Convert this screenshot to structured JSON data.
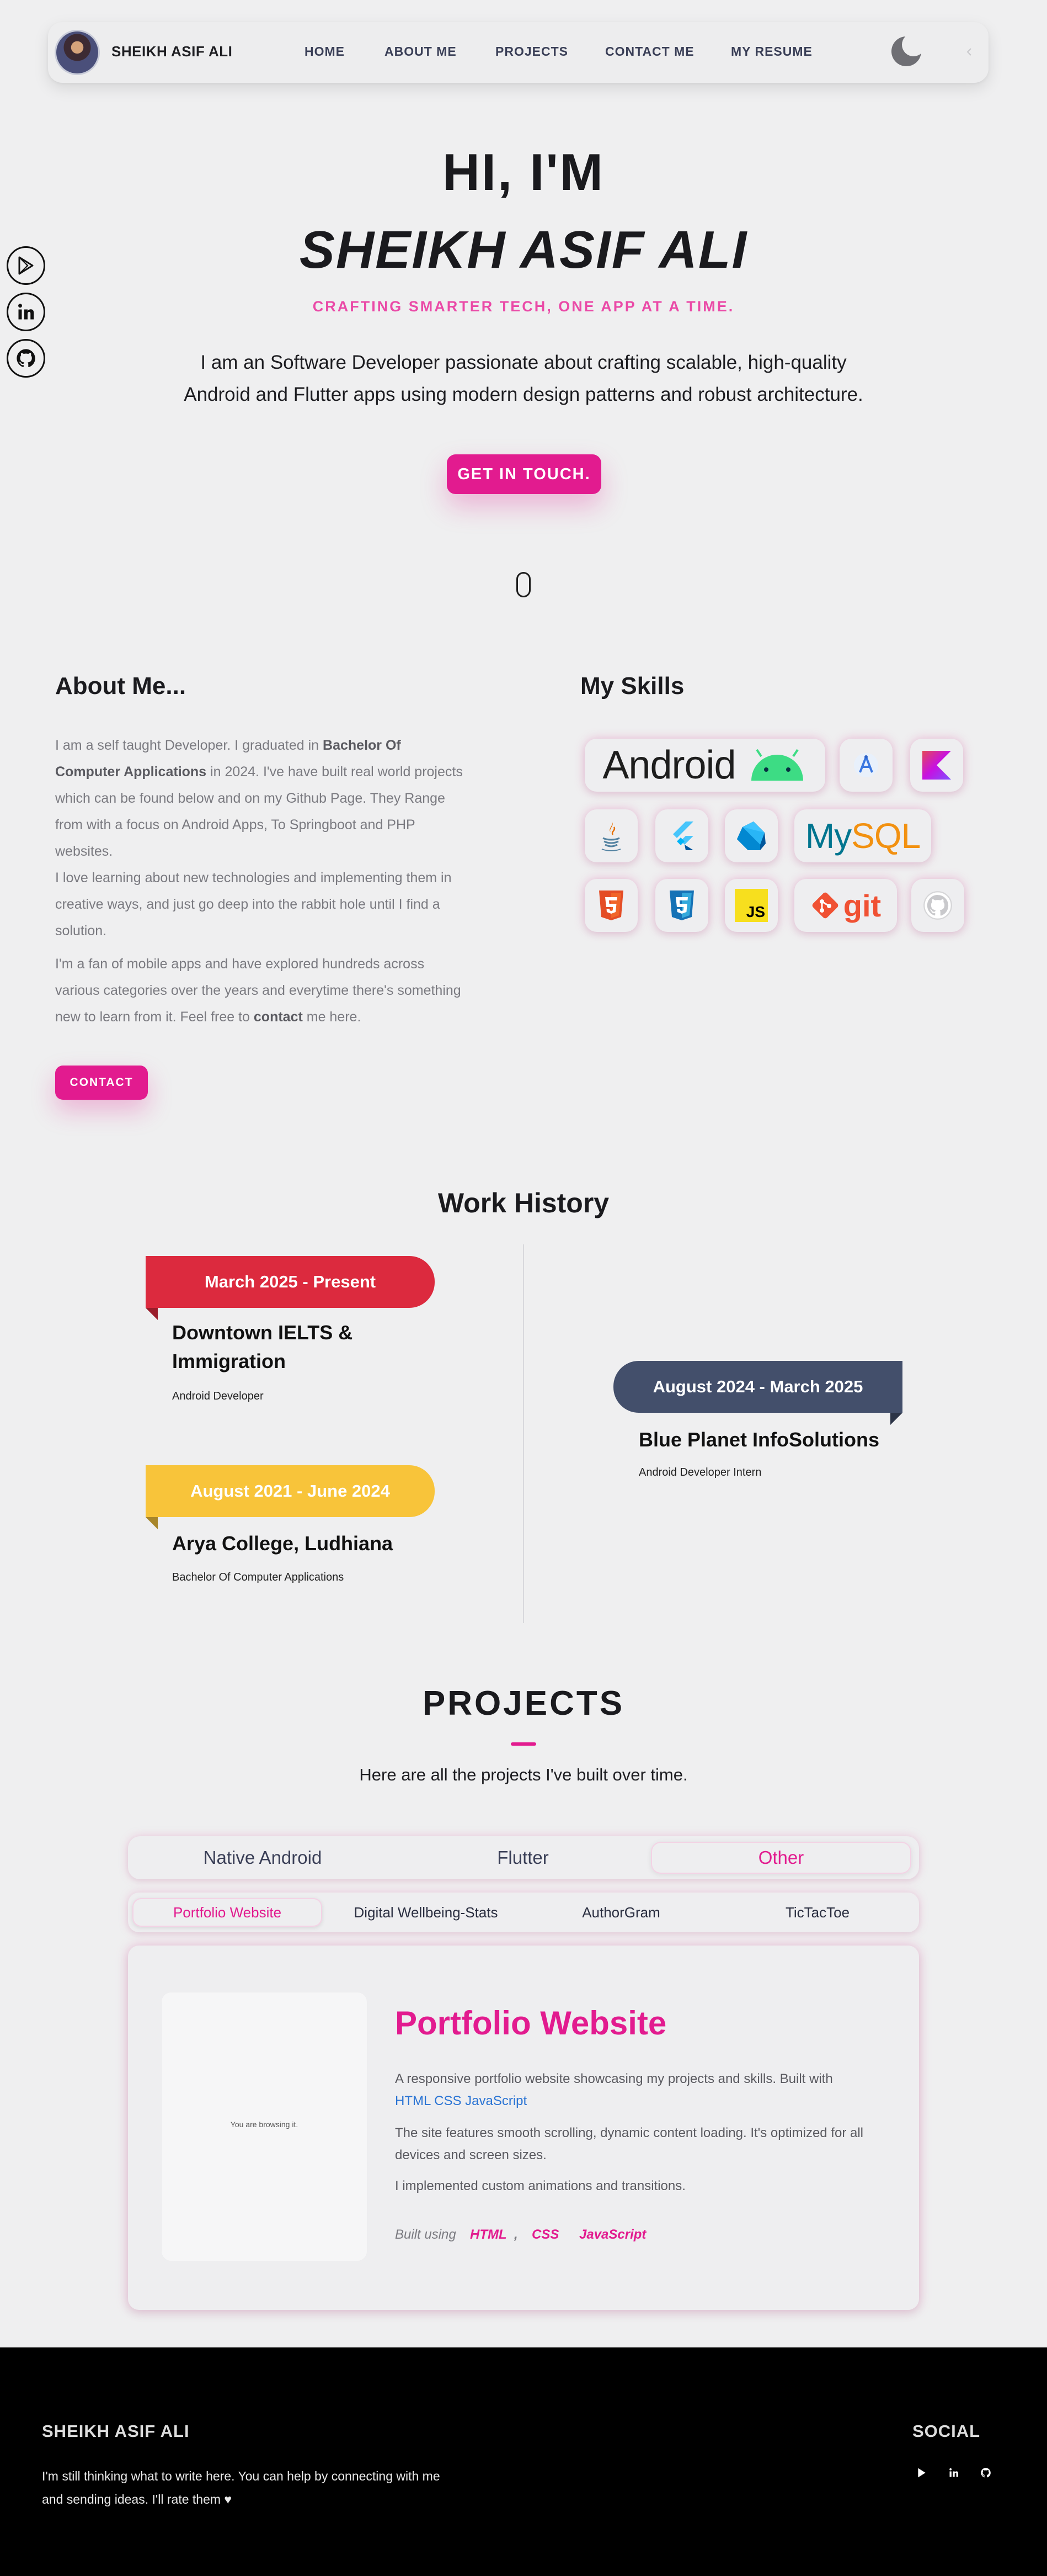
{
  "nav": {
    "brand": "SHEIKH ASIF ALI",
    "links": [
      "HOME",
      "ABOUT ME",
      "PROJECTS",
      "CONTACT ME",
      "MY RESUME"
    ]
  },
  "hero": {
    "greeting": "HI, I'M",
    "name": "SHEIKH ASIF ALI",
    "tagline": "CRAFTING SMARTER TECH, ONE APP AT A TIME.",
    "description_line1": "I am an Software Developer passionate about crafting scalable, high-quality",
    "description_line2": "Android and Flutter apps using modern design patterns and robust architecture.",
    "cta": "GET IN TOUCH."
  },
  "about": {
    "title": "About Me...",
    "p1_start": "I am a self taught Developer. I graduated in ",
    "p1_degree": "Bachelor Of Computer Applications",
    "p1_end": " in 2024. I've have built real world projects which can be found below and on my Github Page. They Range from with a focus on Android Apps, To Springboot and PHP websites.",
    "p2": "I love learning about new technologies and implementing them in creative ways, and just go deep into the rabbit hole until I find a solution.",
    "p3_start": "I'm a fan of mobile apps and have explored hundreds across various categories over the years and everytime there's something new to learn from it. Feel free to ",
    "p3_bold": "contact",
    "p3_end": " me here.",
    "contact_button": "CONTACT"
  },
  "skills": {
    "title": "My Skills",
    "android_label": "Android",
    "mysql_label": "MySQL",
    "git_label": "git",
    "js_label": "JS"
  },
  "work": {
    "title": "Work History",
    "items": [
      {
        "date": "March 2025 - Present",
        "company": "Downtown IELTS & Immigration",
        "role": "Android Developer",
        "color": "#dc2a3e"
      },
      {
        "date": "August 2024 - March 2025",
        "company": "Blue Planet InfoSolutions",
        "role": "Android Developer Intern",
        "color": "#434f6b"
      },
      {
        "date": "August 2021 - June 2024",
        "company": "Arya College, Ludhiana",
        "role": "Bachelor Of Computer Applications",
        "color": "#f8c43a"
      }
    ]
  },
  "projects": {
    "title": "PROJECTS",
    "subtitle": "Here are all the projects I've built over time.",
    "categories": [
      "Native Android",
      "Flutter",
      "Other"
    ],
    "tabs": [
      "Portfolio Website",
      "Digital Wellbeing-Stats",
      "AuthorGram",
      "TicTacToe"
    ],
    "card": {
      "preview_text": "You are browsing it.",
      "name": "Portfolio Website",
      "p1": "A responsive portfolio website showcasing my projects and skills. Built with ",
      "p1_tech": "HTML CSS JavaScript",
      "p2": "The site features smooth scrolling, dynamic content loading. It's optimized for all devices and screen sizes.",
      "p3": "I implemented custom animations and transitions.",
      "built_using": "Built using",
      "tags": [
        "HTML",
        "CSS",
        "JavaScript"
      ],
      "tag_separator": ","
    }
  },
  "footer": {
    "name": "SHEIKH ASIF ALI",
    "text": "I'm still thinking what to write here. You can help by connecting with me and sending ideas. I'll rate them ♥",
    "social_title": "SOCIAL"
  },
  "colors": {
    "accent": "#e21b8f",
    "tagline": "#ea4aa7",
    "link_blue": "#2a74d4",
    "background": "#efeff0"
  },
  "icons": [
    "play-store-icon",
    "linkedin-icon",
    "github-icon",
    "moon-icon",
    "heart-icon"
  ]
}
